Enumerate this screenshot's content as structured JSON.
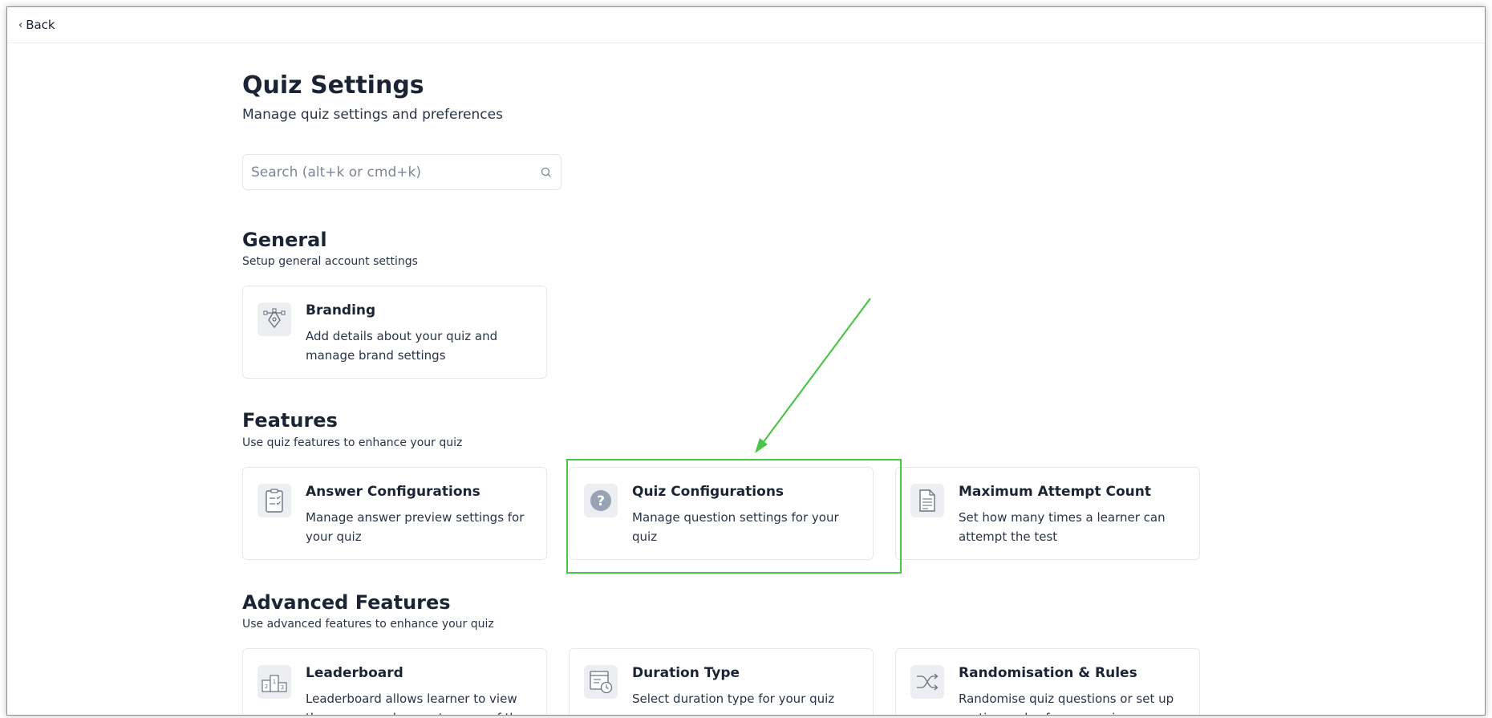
{
  "topbar": {
    "back_label": "Back"
  },
  "header": {
    "title": "Quiz Settings",
    "subtitle": "Manage quiz settings and preferences"
  },
  "search": {
    "placeholder": "Search (alt+k or cmd+k)",
    "value": ""
  },
  "sections": {
    "general": {
      "title": "General",
      "subtitle": "Setup general account settings",
      "cards": [
        {
          "title": "Branding",
          "description": "Add details about your quiz and manage brand settings",
          "icon": "pen-tool-icon"
        }
      ]
    },
    "features": {
      "title": "Features",
      "subtitle": "Use quiz features to enhance your quiz",
      "cards": [
        {
          "title": "Answer Configurations",
          "description": "Manage answer preview settings for your quiz",
          "icon": "clipboard-check-icon"
        },
        {
          "title": "Quiz Configurations",
          "description": "Manage question settings for your quiz",
          "icon": "question-mark-icon"
        },
        {
          "title": "Maximum Attempt Count",
          "description": "Set how many times a learner can attempt the test",
          "icon": "document-icon"
        }
      ]
    },
    "advanced": {
      "title": "Advanced Features",
      "subtitle": "Use advanced features to enhance your quiz",
      "cards": [
        {
          "title": "Leaderboard",
          "description": "Leaderboard allows learner to view the names and current scores of th...",
          "icon": "podium-icon",
          "podium": [
            "2",
            "1",
            "3"
          ]
        },
        {
          "title": "Duration Type",
          "description": "Select duration type for your quiz",
          "icon": "timer-icon"
        },
        {
          "title": "Randomisation & Rules",
          "description": "Randomise quiz questions or set up sections rules for your quiz",
          "icon": "shuffle-icon"
        }
      ]
    }
  },
  "colors": {
    "annotation_green": "#4cc447",
    "icon_bg": "#eceef1",
    "text_dark": "#1c2433"
  }
}
